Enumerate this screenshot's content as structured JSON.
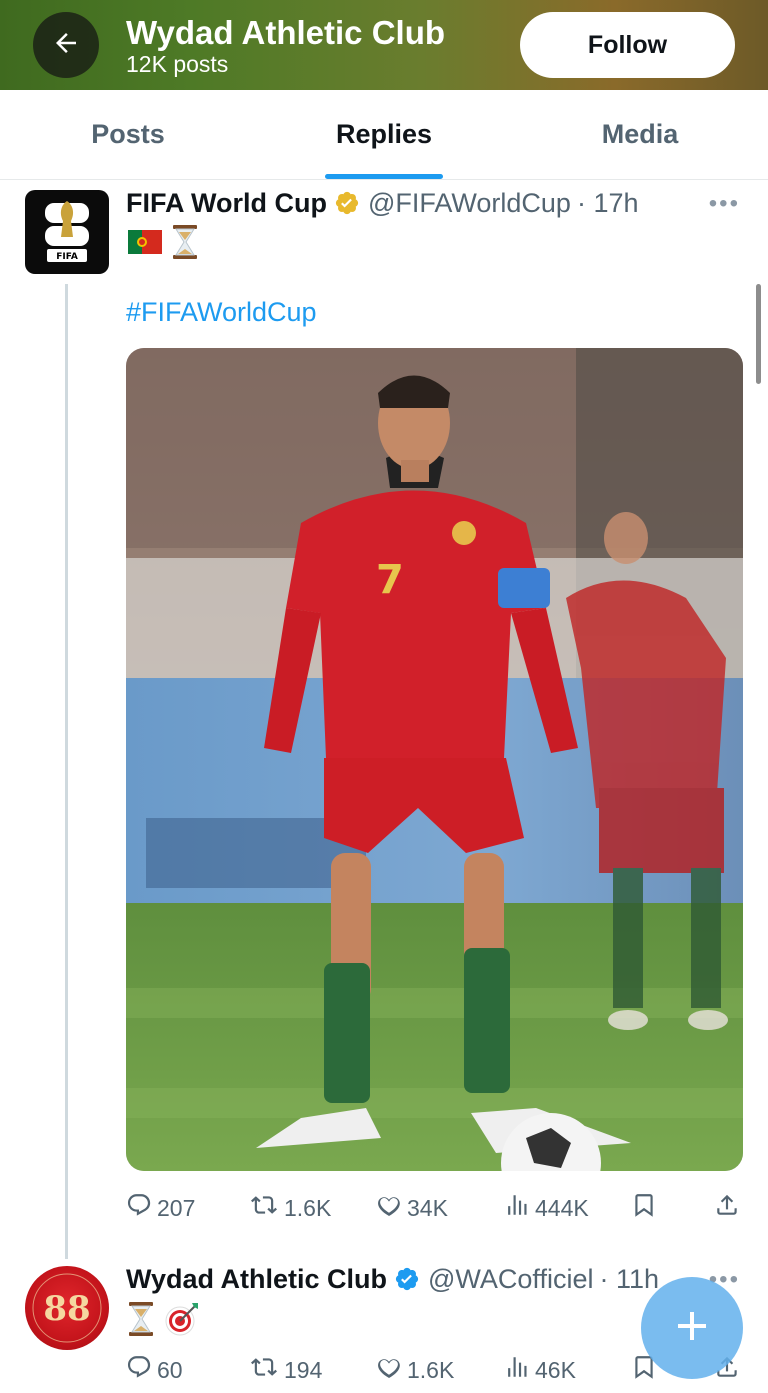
{
  "header": {
    "title": "Wydad Athletic Club",
    "posts_count": "12K posts",
    "follow_label": "Follow",
    "back_icon": "arrow-left-icon"
  },
  "tabs": [
    {
      "label": "Posts",
      "active": false
    },
    {
      "label": "Replies",
      "active": true
    },
    {
      "label": "Media",
      "active": false
    }
  ],
  "colors": {
    "accent": "#1d9bf0",
    "secondary_text": "#536471",
    "verified_gold": "#e8b92d",
    "verified_blue": "#1d9bf0"
  },
  "posts": [
    {
      "name": "FIFA World Cup",
      "verified": "gold",
      "handle": "@FIFAWorldCup",
      "time": "· 17h",
      "emojis": [
        "🇵🇹",
        "⏳"
      ],
      "hashtag": "#FIFAWorldCup",
      "avatar_text": "FIFA",
      "media": "photo",
      "stats": {
        "replies": "207",
        "reposts": "1.6K",
        "likes": "34K",
        "views": "444K"
      }
    },
    {
      "name": "Wydad Athletic Club",
      "verified": "blue",
      "handle": "@WACofficiel",
      "time": "· 11h",
      "emojis": [
        "⏳",
        "🎯"
      ],
      "stats": {
        "replies": "60",
        "reposts": "194",
        "likes": "1.6K",
        "views": "46K"
      }
    }
  ]
}
